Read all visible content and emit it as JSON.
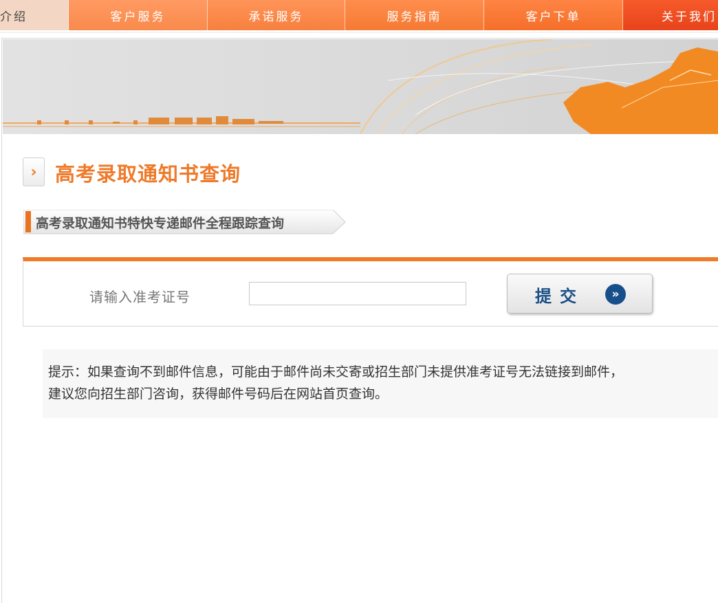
{
  "nav": {
    "items": [
      {
        "label": "介绍"
      },
      {
        "label": "客户服务"
      },
      {
        "label": "承诺服务"
      },
      {
        "label": "服务指南"
      },
      {
        "label": "客户下单"
      },
      {
        "label": "关于我们"
      }
    ]
  },
  "page": {
    "title": "高考录取通知书查询",
    "subtitle": "高考录取通知书特快专递邮件全程跟踪查询"
  },
  "query": {
    "label": "请输入准考证号",
    "input_value": "",
    "input_placeholder": "",
    "submit_label": "提交",
    "submit_icon": "»"
  },
  "hint": {
    "line1": "提示：如果查询不到邮件信息，可能由于邮件尚未交寄或招生部门未提供准考证号无法链接到邮件，",
    "line2": "建议您向招生部门咨询，获得邮件号码后在网站首页查询。"
  },
  "colors": {
    "accent": "#f07c2a",
    "title": "#ee7a2a",
    "button_text": "#1a4f86",
    "banner_bg": "#dcdcdc"
  },
  "icons": {
    "title_marker": "chevron-right-icon",
    "submit": "double-chevron-right-icon"
  }
}
